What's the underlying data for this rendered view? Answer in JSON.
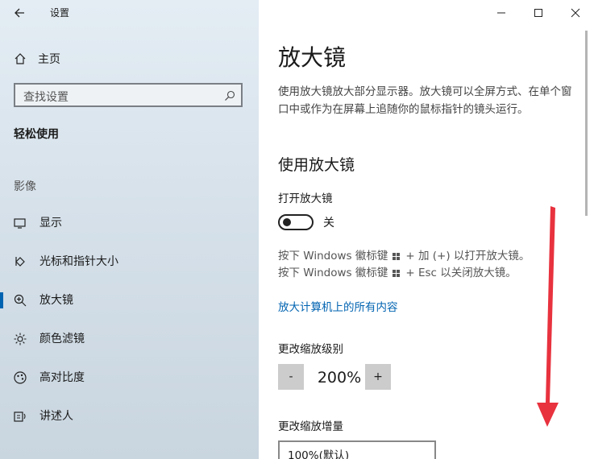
{
  "sidebar": {
    "app_title": "设置",
    "home_label": "主页",
    "search_placeholder": "查找设置",
    "section_label": "轻松使用",
    "group_label": "影像",
    "items": [
      {
        "label": "显示",
        "icon": "display-icon"
      },
      {
        "label": "光标和指针大小",
        "icon": "cursor-icon"
      },
      {
        "label": "放大镜",
        "icon": "magnifier-icon",
        "selected": true
      },
      {
        "label": "颜色滤镜",
        "icon": "color-filter-icon"
      },
      {
        "label": "高对比度",
        "icon": "high-contrast-icon"
      },
      {
        "label": "讲述人",
        "icon": "narrator-icon"
      }
    ]
  },
  "main": {
    "title": "放大镜",
    "description": "使用放大镜放大部分显示器。放大镜可以全屏方式、在单个窗口中或作为在屏幕上追随你的鼠标指针的镜头运行。",
    "section_heading": "使用放大镜",
    "toggle_label": "打开放大镜",
    "toggle_state": "关",
    "toggle_on": false,
    "hint_line1_prefix": "按下 Windows 徽标键",
    "hint_line1_suffix": "+ 加 (+) 以打开放大镜。",
    "hint_line2_prefix": "按下 Windows 徽标键",
    "hint_line2_suffix": "+ Esc 以关闭放大镜。",
    "link_text": "放大计算机上的所有内容",
    "zoom_label": "更改缩放级别",
    "zoom_minus": "-",
    "zoom_value": "200%",
    "zoom_plus": "+",
    "increment_label": "更改缩放增量",
    "increment_value": "100%(默认)"
  },
  "colors": {
    "accent": "#0063b1",
    "arrow": "#e8323e"
  }
}
